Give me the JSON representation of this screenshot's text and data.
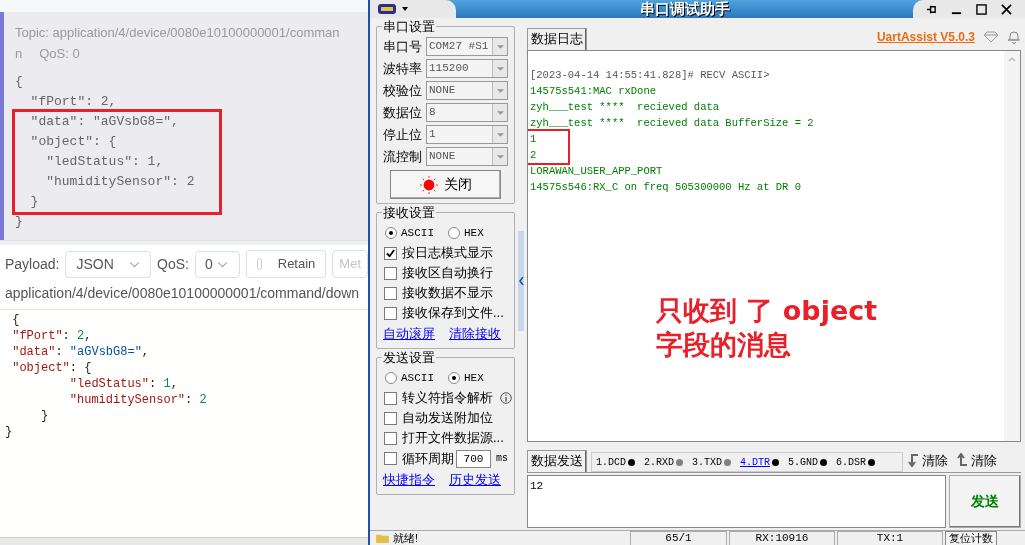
{
  "mqtt_client": {
    "message": {
      "topic": "Topic: application/4/device/0080e10100000001/comman",
      "topic_rest": "n",
      "qos": "QoS: 0",
      "code_blocks": [
        {
          "highlighted": false,
          "lines": [
            "{",
            "  \"fPort\": 2,"
          ]
        },
        {
          "highlighted": true,
          "lines": [
            "  \"data\": \"aGVsbG8=\",",
            "  \"object\": {",
            "    \"ledStatus\": 1,",
            "    \"humiditySensor\": 2",
            "  }"
          ]
        },
        {
          "highlighted": false,
          "lines": [
            "}"
          ]
        }
      ]
    },
    "toolbar": {
      "payload_label": "Payload:",
      "payload_format": "JSON",
      "qos_label": "QoS:",
      "qos_value": "0",
      "retain": {
        "label": "Retain",
        "checked": false
      },
      "meta_button": "Met"
    },
    "publish_topic": "application/4/device/0080e10100000001/command/down",
    "editor_lines": [
      [
        {
          "kind": "punct",
          "text": " {"
        }
      ],
      [
        {
          "kind": "key",
          "text": " \"fPort\""
        },
        {
          "kind": "punct",
          "text": ": "
        },
        {
          "kind": "number",
          "text": "2"
        },
        {
          "kind": "punct",
          "text": ","
        }
      ],
      [
        {
          "kind": "key",
          "text": " \"data\""
        },
        {
          "kind": "punct",
          "text": ": "
        },
        {
          "kind": "string",
          "text": "\"aGVsbG8=\""
        },
        {
          "kind": "punct",
          "text": ","
        }
      ],
      [
        {
          "kind": "key",
          "text": " \"object\""
        },
        {
          "kind": "punct",
          "text": ": {"
        }
      ],
      [
        {
          "kind": "key",
          "text": "         \"ledStatus\""
        },
        {
          "kind": "punct",
          "text": ": "
        },
        {
          "kind": "number",
          "text": "1"
        },
        {
          "kind": "punct",
          "text": ","
        }
      ],
      [
        {
          "kind": "key",
          "text": "         \"humiditySensor\""
        },
        {
          "kind": "punct",
          "text": ": "
        },
        {
          "kind": "number",
          "text": "2"
        }
      ],
      [
        {
          "kind": "punct",
          "text": "     }"
        }
      ],
      [
        {
          "kind": "punct",
          "text": "}"
        }
      ]
    ]
  },
  "serial_tool": {
    "window": {
      "title": "串口调试助手"
    },
    "serial_settings": {
      "title": "串口设置",
      "fields": [
        {
          "label": "串口号",
          "value": "COM27 #S1"
        },
        {
          "label": "波特率",
          "value": "115200"
        },
        {
          "label": "校验位",
          "value": "NONE"
        },
        {
          "label": "数据位",
          "value": "8"
        },
        {
          "label": "停止位",
          "value": "1"
        },
        {
          "label": "流控制",
          "value": "NONE"
        }
      ],
      "port_button": {
        "label": "关闭",
        "open": true
      }
    },
    "receive_settings": {
      "title": "接收设置",
      "modes": [
        {
          "label": "ASCII",
          "selected": true
        },
        {
          "label": "HEX",
          "selected": false
        }
      ],
      "options": [
        {
          "label": "按日志模式显示",
          "checked": true
        },
        {
          "label": "接收区自动换行",
          "checked": false
        },
        {
          "label": "接收数据不显示",
          "checked": false
        },
        {
          "label": "接收保存到文件...",
          "checked": false
        }
      ],
      "links": [
        "自动滚屏",
        "清除接收"
      ]
    },
    "send_settings": {
      "title": "发送设置",
      "modes": [
        {
          "label": "ASCII",
          "selected": false
        },
        {
          "label": "HEX",
          "selected": true
        }
      ],
      "options": [
        {
          "label": "转义符指令解析",
          "checked": false,
          "info": true
        },
        {
          "label": "自动发送附加位",
          "checked": false,
          "info": false
        },
        {
          "label": "打开文件数据源...",
          "checked": false,
          "info": false
        }
      ],
      "cycle": {
        "label": "循环周期",
        "checked": false,
        "value": "700",
        "unit": "ms"
      },
      "links": [
        "快捷指令",
        "历史发送"
      ]
    },
    "log_tab": "数据日志",
    "version_link": "UartAssist V5.0.3",
    "log_blocks": [
      {
        "highlighted": false,
        "lines": [
          {
            "kind": "header",
            "text": "[2023-04-14 14:55:41.828]# RECV ASCII>"
          },
          {
            "kind": "data",
            "text": "14575s541:MAC rxDone"
          },
          {
            "kind": "data",
            "text": "zyh___test ****  recieved data"
          },
          {
            "kind": "data",
            "text": "zyh___test ****  recieved data BufferSize = 2"
          }
        ]
      },
      {
        "highlighted": true,
        "lines": [
          {
            "kind": "data",
            "text": "1"
          },
          {
            "kind": "data",
            "text": "2"
          }
        ]
      },
      {
        "highlighted": false,
        "lines": [
          {
            "kind": "data",
            "text": "LORAWAN_USER_APP_PORT"
          },
          {
            "kind": "data",
            "text": "14575s546:RX_C on freq 505300000 Hz at DR 0"
          }
        ]
      }
    ],
    "annotation": [
      "只收到 了 object",
      "字段的消息"
    ],
    "send_tab": "数据发送",
    "signals": [
      {
        "label": "1.DCD",
        "active": true,
        "link": false
      },
      {
        "label": "2.RXD",
        "active": false,
        "link": false
      },
      {
        "label": "3.TXD",
        "active": false,
        "link": false
      },
      {
        "label": "4.DTR",
        "active": true,
        "link": true
      },
      {
        "label": "5.GND",
        "active": true,
        "link": false
      },
      {
        "label": "6.DSR",
        "active": true,
        "link": false
      }
    ],
    "clear_buttons": [
      {
        "kind": "down",
        "label": "清除"
      },
      {
        "kind": "up",
        "label": "清除"
      }
    ],
    "send_text": "12",
    "send_button": "发送",
    "status_bar": {
      "state": "就绪!",
      "counter": "65/1",
      "rx": "RX:10916",
      "tx": "TX:1",
      "reset_button": "复位计数"
    }
  }
}
